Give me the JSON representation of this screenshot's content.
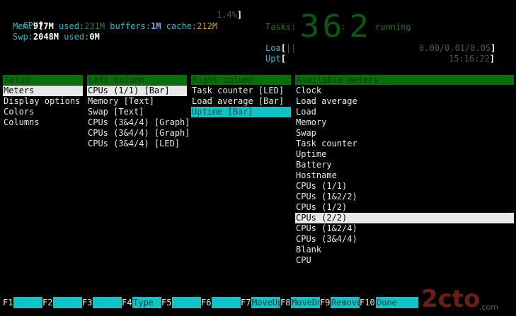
{
  "header": {
    "cpu": {
      "label": "CPU",
      "bracket_open": "[",
      "bar": "|",
      "value": "1.4%",
      "bracket_close": "]"
    },
    "mem": {
      "label": "Mem:",
      "total": "977M",
      "used_label": " used:",
      "used": "231M",
      "buffers_label": " buffers:",
      "buffers": "1M",
      "cache_label": " cache:",
      "cache": "212M"
    },
    "swp": {
      "label": "Swp:",
      "total": "2048M",
      "used_label": " used:",
      "used": "0M"
    },
    "tasks": {
      "label": "Tasks:",
      "count": "36",
      "sep": ":",
      "running": "2",
      "running_label": "running"
    },
    "load": {
      "label": "Loa",
      "bracket_open": "[",
      "bar": "||",
      "value": "0.00/0.01/0.05",
      "bracket_close": "]"
    },
    "uptime": {
      "label": "Upt",
      "bracket_open": "[",
      "value": "15:16:22",
      "bracket_close": "]"
    }
  },
  "setup": {
    "header": "Setup",
    "items": [
      "Meters",
      "Display options",
      "Colors",
      "Columns"
    ]
  },
  "left_column": {
    "header": "Left column",
    "items": [
      "CPUs (1/1) [Bar]",
      "Memory [Text]",
      "Swap [Text]",
      "CPUs (3&4/4) [Graph]",
      "CPUs (3&4/4) [Graph]",
      "CPUs (3&4/4) [LED]"
    ]
  },
  "right_column": {
    "header": "Right column",
    "items": [
      "Task counter [LED]",
      "Load average [Bar]",
      "Uptime [Bar]"
    ]
  },
  "available_meters": {
    "header": "Available meters",
    "items": [
      "Clock",
      "Load average",
      "Load",
      "Memory",
      "Swap",
      "Task counter",
      "Uptime",
      "Battery",
      "Hostname",
      "CPUs (1/1)",
      "CPUs (1&2/2)",
      "CPUs (1/2)",
      "CPUs (2/2)",
      "CPUs (1&2/4)",
      "CPUs (3&4/4)",
      "Blank",
      "CPU"
    ]
  },
  "footer": {
    "keys": [
      {
        "key": "F1",
        "label": ""
      },
      {
        "key": "F2",
        "label": ""
      },
      {
        "key": "F3",
        "label": ""
      },
      {
        "key": "F4",
        "label": "Type"
      },
      {
        "key": "F5",
        "label": ""
      },
      {
        "key": "F6",
        "label": ""
      },
      {
        "key": "F7",
        "label": "MoveUp"
      },
      {
        "key": "F8",
        "label": "MoveDn"
      },
      {
        "key": "F9",
        "label": "Remove"
      },
      {
        "key": "F10",
        "label": "Done"
      }
    ]
  },
  "watermark": {
    "logo": "2cto",
    "suffix": ".com"
  },
  "colors": {
    "header_green": "#0a6e0a",
    "selection_cyan": "#0fc4c4",
    "selection_white": "#e8e8e8",
    "meter_cyan": "#2bb8c8",
    "cache_yellow": "#c9a227",
    "led_green": "#0a5a0a"
  }
}
